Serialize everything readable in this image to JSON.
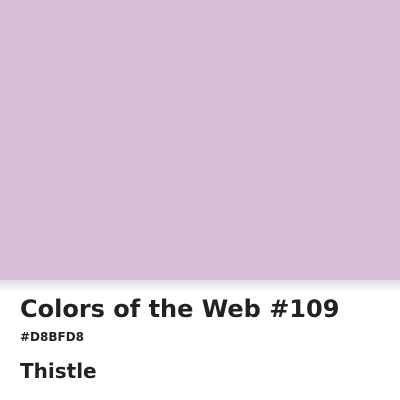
{
  "swatch": {
    "color": "#D8BFD8"
  },
  "caption": {
    "title": "Colors of the Web #109",
    "hex": "#D8BFD8",
    "name": "Thistle"
  },
  "colors": {
    "text": "#222222",
    "background": "#ffffff"
  }
}
